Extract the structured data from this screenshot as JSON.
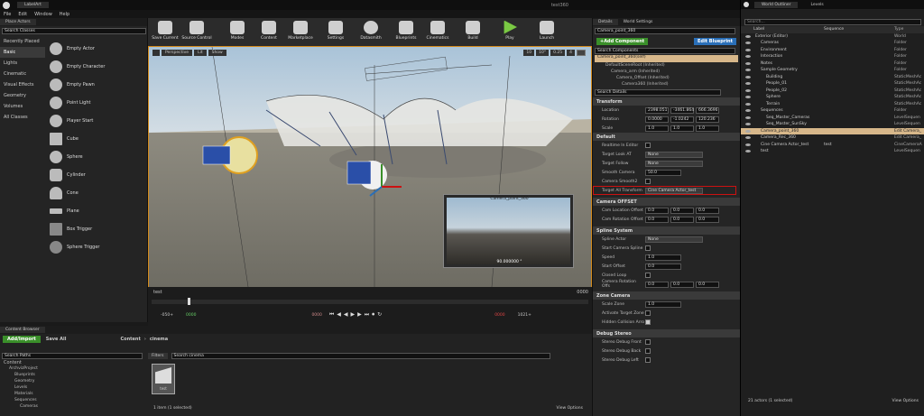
{
  "window": {
    "tab": "LabelArt",
    "title": "test360"
  },
  "menu": [
    "File",
    "Edit",
    "Window",
    "Help"
  ],
  "place_actors": {
    "tab": "Place Actors",
    "search_placeholder": "Search Classes",
    "categories": [
      "Recently Placed",
      "Basic",
      "Lights",
      "Cinematic",
      "Visual Effects",
      "Geometry",
      "Volumes",
      "All Classes"
    ],
    "selected": "Basic",
    "actors": [
      "Empty Actor",
      "Empty Character",
      "Empty Pawn",
      "Point Light",
      "Player Start",
      "Cube",
      "Sphere",
      "Cylinder",
      "Cone",
      "Plane",
      "Box Trigger",
      "Sphere Trigger"
    ]
  },
  "toolbar": [
    "Save Current",
    "Source Control",
    "Modes",
    "Content",
    "Marketplace",
    "Settings",
    "Datasmith",
    "Blueprints",
    "Cinematics",
    "Build",
    "Play",
    "Launch"
  ],
  "viewport": {
    "perspective": "Perspective",
    "lit": "Lit",
    "show": "Show",
    "snap": "10",
    "angle": "10°",
    "scale": "0.25",
    "cams": "4"
  },
  "preview": {
    "title": "Camera_point_360",
    "fov": "90.000000 °"
  },
  "sequencer": {
    "name": "test",
    "start_frame": "0000",
    "left_time": "-050+",
    "left_green": "0000",
    "cursor": "0000",
    "right_red": "0000",
    "right_time": "1021+"
  },
  "content_browser": {
    "tab": "Content Browser",
    "add_import": "Add/Import",
    "save_all": "Save All",
    "path": [
      "Content",
      "cinema"
    ],
    "search_paths": "Search Paths",
    "filters": "Filters",
    "search_placeholder": "Search cinema",
    "tree": [
      "Content",
      "ArchvizProject",
      "Blueprints",
      "Geometry",
      "Levels",
      "Materials",
      "Sequences",
      "Cameras"
    ],
    "asset": "test",
    "status": "1 item (1 selected)",
    "view_options": "View Options"
  },
  "details": {
    "tabs": [
      "Details",
      "World Settings"
    ],
    "actor": "Camera_point_360",
    "add_component": "+Add Component",
    "edit_blueprint": "Edit Blueprint",
    "search_components": "Search Components",
    "components": [
      "Camera_point_360(self)",
      "DefaultSceneRoot (Inherited)",
      "Camera_arm (Inherited)",
      "Camera_Offset (Inherited)",
      "Camera360 (Inherited)"
    ],
    "search_details": "Search Details",
    "transform": {
      "label": "Transform",
      "location_label": "Location",
      "location": [
        "2398.051",
        "-3461.864",
        "666.3696"
      ],
      "rotation_label": "Rotation",
      "rotation": [
        "0.0000",
        "-1.0242",
        "120.236"
      ],
      "scale_label": "Scale",
      "scale": [
        "1.0",
        "1.0",
        "1.0"
      ]
    },
    "default": {
      "label": "Default",
      "realtime": "Realtime In Editor",
      "look_at": "Target Look AT",
      "look_at_val": "None",
      "follow": "Target Follow",
      "follow_val": "None",
      "smooth": "Smooth Camera",
      "smooth_val": "50.0",
      "smooth2": "Camera Smooth2",
      "all_transform": "Target All Transform",
      "all_transform_val": "Cine Camera Actor_test"
    },
    "offset": {
      "label": "Camera OFFSET",
      "loc": "Cam Location Offset",
      "rot": "Cam Rotation Offset",
      "x": "0.0",
      "y": "0.0",
      "z": "0.0"
    },
    "spline": {
      "label": "Spline System",
      "actor": "Spline Actor",
      "actor_val": "None",
      "start": "Start Camera Spline",
      "speed": "Speed",
      "speed_val": "1.0",
      "offset": "Start Offset",
      "offset_val": "0.0",
      "closed": "Closed Loop",
      "rot": "Camera Rotation Offs",
      "x": "0.0",
      "y": "0.0",
      "z": "0.0"
    },
    "zone": {
      "label": "Zone Camera",
      "scale": "Scale Zone",
      "scale_val": "1.0",
      "activate": "Activate Target Zone",
      "hidden": "Hidden Collision Arro"
    },
    "stereo": {
      "label": "Debug Stereo",
      "front": "Stereo Debug Front",
      "back": "Stereo Debug Back",
      "left": "Stereo Debug Left"
    }
  },
  "outliner": {
    "tabs": [
      "World Outliner",
      "Levels"
    ],
    "search_placeholder": "Search...",
    "col_label": "Label",
    "col_seq": "Sequence",
    "col_type": "Type",
    "rows": [
      {
        "name": "Exterior (Editor)",
        "type": "World",
        "indent": 0
      },
      {
        "name": "Cameras",
        "type": "Folder",
        "indent": 1
      },
      {
        "name": "Environment",
        "type": "Folder",
        "indent": 1
      },
      {
        "name": "Interaction",
        "type": "Folder",
        "indent": 1
      },
      {
        "name": "Notes",
        "type": "Folder",
        "indent": 1
      },
      {
        "name": "Sample Geometry",
        "type": "Folder",
        "indent": 1
      },
      {
        "name": "Building",
        "type": "StaticMeshAc",
        "indent": 2
      },
      {
        "name": "People_01",
        "type": "StaticMeshAc",
        "indent": 2
      },
      {
        "name": "People_02",
        "type": "StaticMeshAc",
        "indent": 2
      },
      {
        "name": "Sphere",
        "type": "StaticMeshAc",
        "indent": 2
      },
      {
        "name": "Terrain",
        "type": "StaticMeshAc",
        "indent": 2
      },
      {
        "name": "Sequences",
        "type": "Folder",
        "indent": 1
      },
      {
        "name": "Seq_Master_Cameras",
        "type": "LevelSequen",
        "indent": 2
      },
      {
        "name": "Seq_Master_SunSky",
        "type": "LevelSequen",
        "indent": 2
      },
      {
        "name": "Camera_point_360",
        "type": "Edit Camera_",
        "indent": 1,
        "selected": true
      },
      {
        "name": "Camera_Rec_360",
        "type": "Edit Camera_",
        "indent": 1
      },
      {
        "name": "Cine Camera Actor_test",
        "type": "CineCameraA",
        "indent": 1,
        "seq": "test"
      },
      {
        "name": "test",
        "type": "LevelSequen",
        "indent": 1
      }
    ],
    "status": "21 actors (1 selected)",
    "view_options": "View Options"
  },
  "colors": {
    "accent": "#e0a020",
    "highlight": "#cc1111",
    "green": "#3a8f2a",
    "blue": "#2a6fb8"
  }
}
